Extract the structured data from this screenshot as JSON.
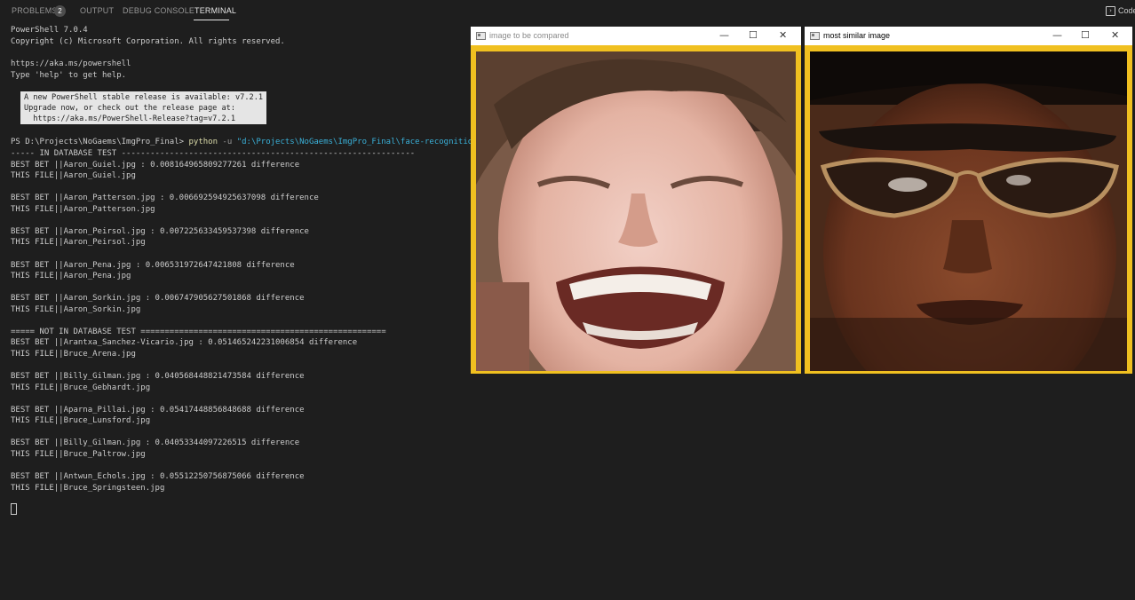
{
  "panel": {
    "tabs": [
      {
        "label": "PROBLEMS",
        "badge": "2"
      },
      {
        "label": "OUTPUT"
      },
      {
        "label": "DEBUG CONSOLE"
      },
      {
        "label": "TERMINAL"
      }
    ],
    "active_tab": "TERMINAL",
    "right_button_label": "Code"
  },
  "terminal": {
    "header": [
      "PowerShell 7.0.4",
      "Copyright (c) Microsoft Corporation. All rights reserved.",
      "",
      "https://aka.ms/powershell",
      "Type 'help' to get help."
    ],
    "notice": [
      "A new PowerShell stable release is available: v7.2.1",
      "Upgrade now, or check out the release page at:",
      "  https://aka.ms/PowerShell-Release?tag=v7.2.1"
    ],
    "prompt": {
      "prefix": "PS D:\\Projects\\NoGaems\\ImgPro_Final> ",
      "command": "python",
      "flag": " -u ",
      "path": "\"d:\\Projects\\NoGaems\\ImgPro_Final\\face-recognition.py"
    },
    "output": [
      "----- IN DATABASE TEST -------------------------------------------------------------",
      "BEST BET ||Aaron_Guiel.jpg : 0.008164965809277261 difference",
      "THIS FILE||Aaron_Guiel.jpg",
      "",
      "BEST BET ||Aaron_Patterson.jpg : 0.006692594925637098 difference",
      "THIS FILE||Aaron_Patterson.jpg",
      "",
      "BEST BET ||Aaron_Peirsol.jpg : 0.007225633459537398 difference",
      "THIS FILE||Aaron_Peirsol.jpg",
      "",
      "BEST BET ||Aaron_Pena.jpg : 0.006531972647421808 difference",
      "THIS FILE||Aaron_Pena.jpg",
      "",
      "BEST BET ||Aaron_Sorkin.jpg : 0.006747905627501868 difference",
      "THIS FILE||Aaron_Sorkin.jpg",
      "",
      "===== NOT IN DATABASE TEST ===================================================",
      "BEST BET ||Arantxa_Sanchez-Vicario.jpg : 0.051465242231006854 difference",
      "THIS FILE||Bruce_Arena.jpg",
      "",
      "BEST BET ||Billy_Gilman.jpg : 0.040568448821473584 difference",
      "THIS FILE||Bruce_Gebhardt.jpg",
      "",
      "BEST BET ||Aparna_Pillai.jpg : 0.05417448856848688 difference",
      "THIS FILE||Bruce_Lunsford.jpg",
      "",
      "BEST BET ||Billy_Gilman.jpg : 0.04053344097226515 difference",
      "THIS FILE||Bruce_Paltrow.jpg",
      "",
      "BEST BET ||Antwun_Echols.jpg : 0.05512250756875066 difference",
      "THIS FILE||Bruce_Springsteen.jpg"
    ]
  },
  "windows": [
    {
      "title": "image to be compared",
      "border_color": "#f0c020",
      "image_icon": "laughing-face-photo"
    },
    {
      "title": "most similar image",
      "border_color": "#f0c020",
      "image_icon": "sunglasses-face-photo"
    }
  ],
  "window_controls": {
    "minimize": "—",
    "maximize": "☐",
    "close": "✕"
  }
}
